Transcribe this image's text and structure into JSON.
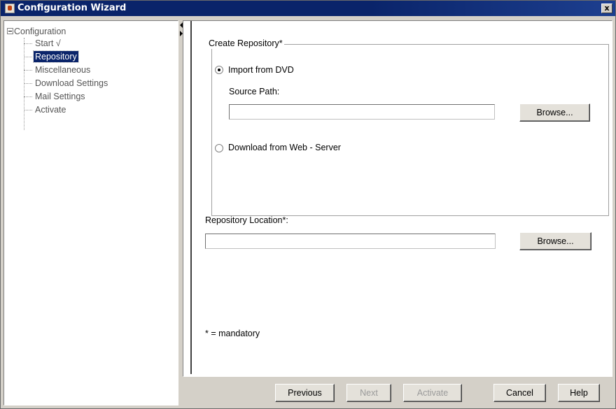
{
  "window": {
    "title": "Configuration Wizard",
    "close_glyph": "x"
  },
  "tree": {
    "root_label": "Configuration",
    "items": [
      {
        "label": "Start √"
      },
      {
        "label": "Repository"
      },
      {
        "label": "Miscellaneous"
      },
      {
        "label": "Download Settings"
      },
      {
        "label": "Mail Settings"
      },
      {
        "label": "Activate"
      }
    ],
    "selected": "Repository"
  },
  "create_repository": {
    "group_label": "Create Repository*",
    "import_dvd_label": "Import from DVD",
    "import_dvd_checked": true,
    "source_path_label": "Source Path:",
    "source_path_value": "",
    "browse_label": "Browse...",
    "download_web_label": "Download from Web - Server",
    "download_web_checked": false
  },
  "repository_location": {
    "label": "Repository Location*:",
    "value": "",
    "browse_label": "Browse..."
  },
  "footnote": "* = mandatory",
  "buttons": {
    "previous": "Previous",
    "next": "Next",
    "activate": "Activate",
    "cancel": "Cancel",
    "help": "Help"
  },
  "colors": {
    "titlebar": "#0a246a",
    "selection": "#0a246a",
    "face": "#d4d0c8"
  }
}
